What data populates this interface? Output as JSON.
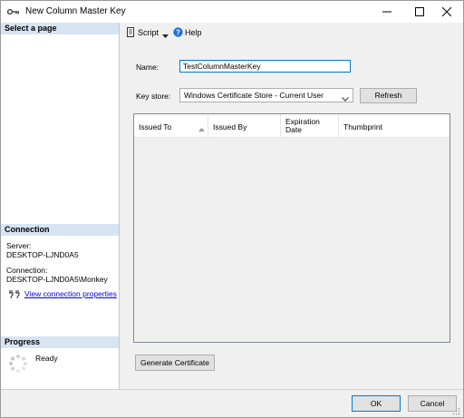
{
  "window": {
    "title": "New Column Master Key",
    "minimize_glyph": "minimize-icon",
    "maximize_glyph": "maximize-icon",
    "close_glyph": "close-icon"
  },
  "left_pane": {
    "select_page_header": "Select a page",
    "connection": {
      "header": "Connection",
      "server_label": "Server:",
      "server_value": "DESKTOP-LJND0A5",
      "connection_label": "Connection:",
      "connection_value": "DESKTOP-LJND0A5\\Monkey",
      "view_properties_link": "View connection properties"
    },
    "progress": {
      "header": "Progress",
      "status": "Ready"
    }
  },
  "toolbar": {
    "script_label": "Script",
    "help_label": "Help"
  },
  "form": {
    "name_label": "Name:",
    "name_value": "TestColumnMasterKey",
    "key_store_label": "Key store:",
    "key_store_value": "Windows Certificate Store - Current User",
    "refresh_label": "Refresh",
    "generate_label": "Generate Certificate"
  },
  "grid": {
    "columns": [
      "Issued To",
      "Issued By",
      "Expiration",
      "Date",
      "Thumbprint"
    ],
    "rows": []
  },
  "footer": {
    "ok_label": "OK",
    "cancel_label": "Cancel"
  },
  "colors": {
    "section_header_bg": "#d7e4f2",
    "accent": "#0078d7",
    "link": "#0000ee"
  }
}
